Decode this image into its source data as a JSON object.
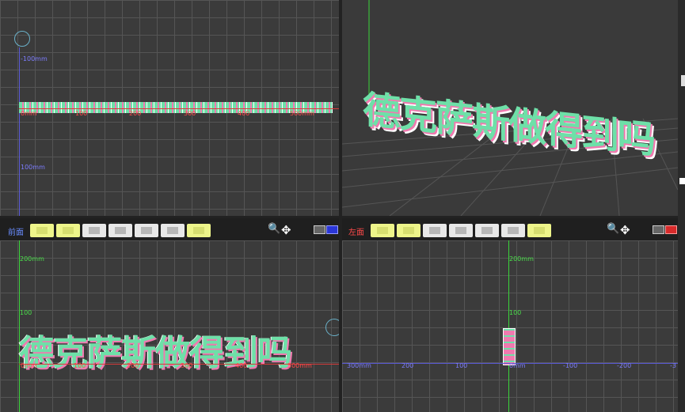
{
  "viewports": {
    "top_view": {
      "labels": {
        "y_neg": "-100mm",
        "y_pos": "100mm"
      },
      "x_ticks": [
        "0mm",
        "100",
        "200",
        "300",
        "400",
        "500mm"
      ]
    },
    "perspective": {
      "text_3d": "德克萨斯做得到吗"
    },
    "front": {
      "name": "前面",
      "labels": {
        "y_top": "200mm",
        "y_mid": "100"
      },
      "x_ticks": [
        "0mm",
        "100",
        "200",
        "300",
        "400",
        "500mm"
      ],
      "text": "德克萨斯做得到吗"
    },
    "left": {
      "name": "左面",
      "labels": {
        "y_top": "200mm",
        "y_mid": "100"
      },
      "x_ticks": [
        "300mm",
        "200",
        "100",
        "0mm",
        "-100",
        "-200",
        "-3"
      ]
    }
  },
  "toolbar": {
    "buttons": [
      "view-button",
      "view-button",
      "solid-button",
      "shape-button",
      "pattern-button",
      "settings-button",
      "expand-button"
    ],
    "tools": {
      "zoom": "🔍",
      "move": "✥"
    },
    "colors": {
      "highlight": "#eef58a",
      "monitor_front": "#2a36d8",
      "monitor_left": "#d82a2a"
    }
  }
}
